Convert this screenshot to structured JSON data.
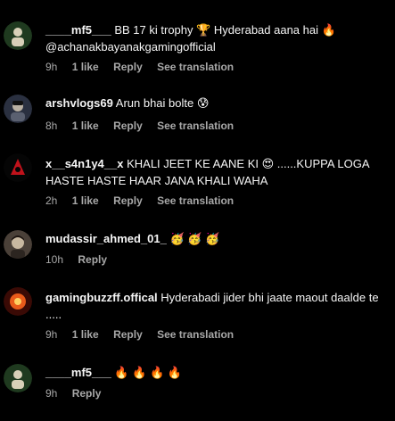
{
  "comments": [
    {
      "username": "____mf5___",
      "text": " BB 17 ki trophy 🏆  Hyderabad aana hai 🔥 @achanakbayanakgamingofficial",
      "time": "9h",
      "likes": "1 like",
      "reply": "Reply",
      "translate": "See translation",
      "avatar_colors": [
        "#1f3a1f",
        "#d8d0b8"
      ]
    },
    {
      "username": "arshvlogs69",
      "text": " Arun bhai bolte 😰",
      "time": "8h",
      "likes": "1 like",
      "reply": "Reply",
      "translate": "See translation",
      "avatar_colors": [
        "#2a3040",
        "#b9b0a2"
      ]
    },
    {
      "username": "x__s4n1y4__x",
      "text": " KHALI JEET KE AANE KI 😍 ......KUPPA LOGA HASTE HASTE HAAR JANA KHALI WAHA",
      "time": "2h",
      "likes": "1 like",
      "reply": "Reply",
      "translate": "See translation",
      "avatar_colors": [
        "#050505",
        "#c0121b"
      ]
    },
    {
      "username": "mudassir_ahmed_01_",
      "text": " 🥳 🥳 🥳",
      "time": "10h",
      "reply": "Reply",
      "avatar_colors": [
        "#4a4038",
        "#c8b8a0"
      ]
    },
    {
      "username": "gamingbuzzff.offical",
      "text": " Hyderabadi jider bhi jaate maout daalde te .....",
      "time": "9h",
      "likes": "1 like",
      "reply": "Reply",
      "translate": "See translation",
      "avatar_colors": [
        "#3a0a05",
        "#e85a1a"
      ]
    },
    {
      "username": "____mf5___",
      "text": " 🔥 🔥 🔥 🔥",
      "time": "9h",
      "reply": "Reply",
      "avatar_colors": [
        "#1f3a1f",
        "#d8d0b8"
      ]
    }
  ]
}
